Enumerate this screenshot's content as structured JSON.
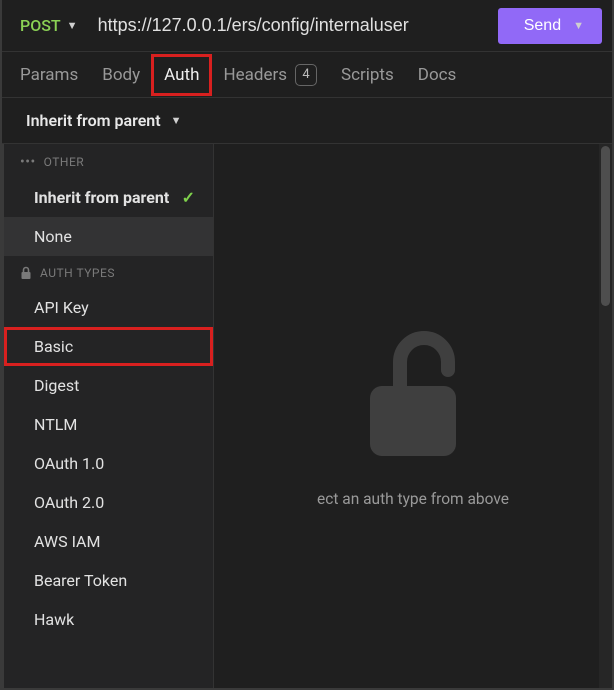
{
  "request": {
    "method": "POST",
    "url": "https://127.0.0.1/ers/config/internaluser",
    "sendLabel": "Send"
  },
  "tabs": {
    "params": "Params",
    "body": "Body",
    "auth": "Auth",
    "headers": "Headers",
    "headersCount": "4",
    "scripts": "Scripts",
    "docs": "Docs"
  },
  "authDropdown": {
    "current": "Inherit from parent"
  },
  "sections": {
    "other": "OTHER",
    "authTypes": "AUTH TYPES"
  },
  "authOptions": {
    "inherit": "Inherit from parent",
    "none": "None",
    "apiKey": "API Key",
    "basic": "Basic",
    "digest": "Digest",
    "ntlm": "NTLM",
    "oauth1": "OAuth 1.0",
    "oauth2": "OAuth 2.0",
    "awsIam": "AWS IAM",
    "bearer": "Bearer Token",
    "hawk": "Hawk"
  },
  "emptyState": {
    "text": "ect an auth type from above"
  }
}
